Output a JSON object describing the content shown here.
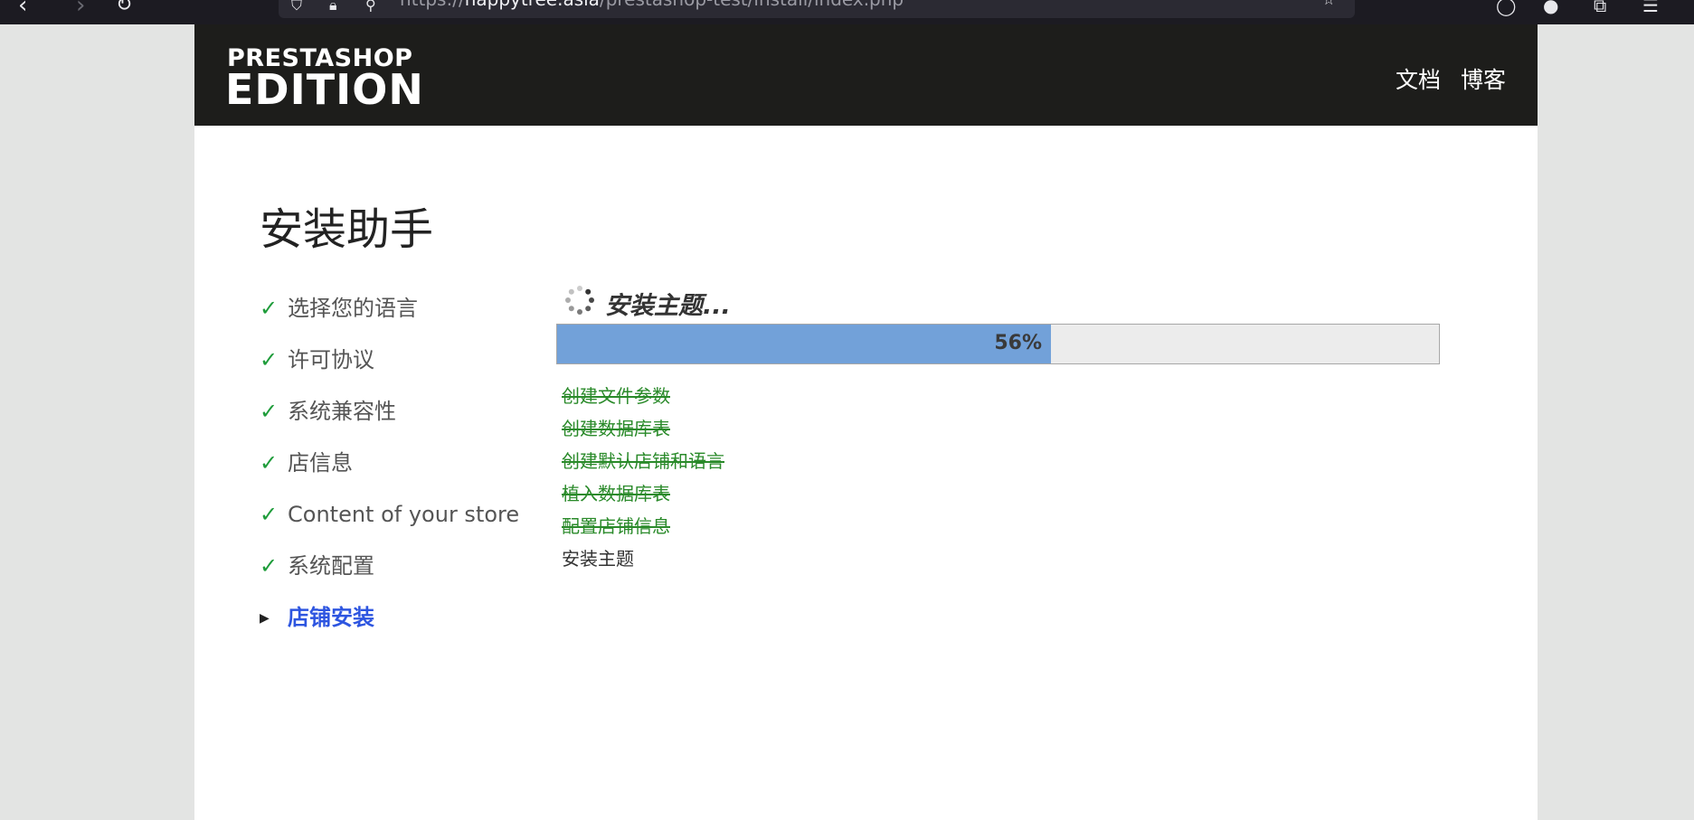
{
  "browser": {
    "url_scheme": "https://",
    "url_host": "happytree.asia",
    "url_path": "/prestashop-test/install/index.php"
  },
  "header": {
    "logo_line1": "PRESTASHOP",
    "logo_line2": "EDITION",
    "links": [
      "文档",
      "博客"
    ]
  },
  "title": "安装助手",
  "steps": [
    {
      "label": "选择您的语言",
      "status": "done"
    },
    {
      "label": "许可协议",
      "status": "done"
    },
    {
      "label": "系统兼容性",
      "status": "done"
    },
    {
      "label": "店信息",
      "status": "done"
    },
    {
      "label": "Content of your store",
      "status": "done"
    },
    {
      "label": "系统配置",
      "status": "done"
    },
    {
      "label": "店铺安装",
      "status": "current"
    }
  ],
  "install": {
    "status_text": "安装主题...",
    "progress_percent": 56,
    "progress_label": "56%",
    "log": [
      {
        "text": "创建文件参数",
        "done": true
      },
      {
        "text": "创建数据库表",
        "done": true
      },
      {
        "text": "创建默认店铺和语言",
        "done": true
      },
      {
        "text": "植入数据库表",
        "done": true
      },
      {
        "text": "配置店铺信息",
        "done": true
      },
      {
        "text": "安装主题",
        "done": false
      }
    ]
  },
  "colors": {
    "header_bg": "#1d1d1b",
    "progress_fill": "#72a1d9",
    "check_green": "#1e9c3a",
    "active_blue": "#2d55e0",
    "log_done_green": "#2a8a2a"
  }
}
